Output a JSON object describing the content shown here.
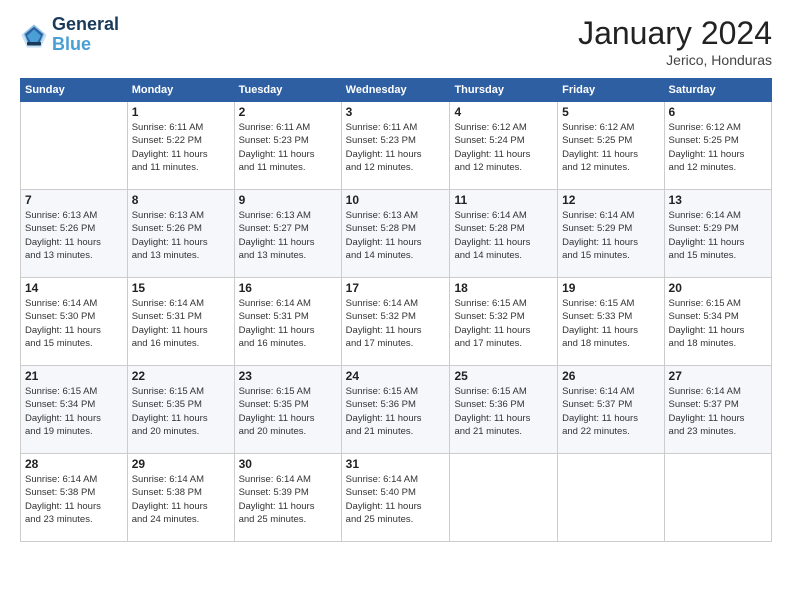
{
  "logo": {
    "line1": "General",
    "line2": "Blue"
  },
  "header": {
    "month": "January 2024",
    "location": "Jerico, Honduras"
  },
  "weekdays": [
    "Sunday",
    "Monday",
    "Tuesday",
    "Wednesday",
    "Thursday",
    "Friday",
    "Saturday"
  ],
  "weeks": [
    [
      {
        "day": "",
        "info": ""
      },
      {
        "day": "1",
        "info": "Sunrise: 6:11 AM\nSunset: 5:22 PM\nDaylight: 11 hours\nand 11 minutes."
      },
      {
        "day": "2",
        "info": "Sunrise: 6:11 AM\nSunset: 5:23 PM\nDaylight: 11 hours\nand 11 minutes."
      },
      {
        "day": "3",
        "info": "Sunrise: 6:11 AM\nSunset: 5:23 PM\nDaylight: 11 hours\nand 12 minutes."
      },
      {
        "day": "4",
        "info": "Sunrise: 6:12 AM\nSunset: 5:24 PM\nDaylight: 11 hours\nand 12 minutes."
      },
      {
        "day": "5",
        "info": "Sunrise: 6:12 AM\nSunset: 5:25 PM\nDaylight: 11 hours\nand 12 minutes."
      },
      {
        "day": "6",
        "info": "Sunrise: 6:12 AM\nSunset: 5:25 PM\nDaylight: 11 hours\nand 12 minutes."
      }
    ],
    [
      {
        "day": "7",
        "info": "Sunrise: 6:13 AM\nSunset: 5:26 PM\nDaylight: 11 hours\nand 13 minutes."
      },
      {
        "day": "8",
        "info": "Sunrise: 6:13 AM\nSunset: 5:26 PM\nDaylight: 11 hours\nand 13 minutes."
      },
      {
        "day": "9",
        "info": "Sunrise: 6:13 AM\nSunset: 5:27 PM\nDaylight: 11 hours\nand 13 minutes."
      },
      {
        "day": "10",
        "info": "Sunrise: 6:13 AM\nSunset: 5:28 PM\nDaylight: 11 hours\nand 14 minutes."
      },
      {
        "day": "11",
        "info": "Sunrise: 6:14 AM\nSunset: 5:28 PM\nDaylight: 11 hours\nand 14 minutes."
      },
      {
        "day": "12",
        "info": "Sunrise: 6:14 AM\nSunset: 5:29 PM\nDaylight: 11 hours\nand 15 minutes."
      },
      {
        "day": "13",
        "info": "Sunrise: 6:14 AM\nSunset: 5:29 PM\nDaylight: 11 hours\nand 15 minutes."
      }
    ],
    [
      {
        "day": "14",
        "info": "Sunrise: 6:14 AM\nSunset: 5:30 PM\nDaylight: 11 hours\nand 15 minutes."
      },
      {
        "day": "15",
        "info": "Sunrise: 6:14 AM\nSunset: 5:31 PM\nDaylight: 11 hours\nand 16 minutes."
      },
      {
        "day": "16",
        "info": "Sunrise: 6:14 AM\nSunset: 5:31 PM\nDaylight: 11 hours\nand 16 minutes."
      },
      {
        "day": "17",
        "info": "Sunrise: 6:14 AM\nSunset: 5:32 PM\nDaylight: 11 hours\nand 17 minutes."
      },
      {
        "day": "18",
        "info": "Sunrise: 6:15 AM\nSunset: 5:32 PM\nDaylight: 11 hours\nand 17 minutes."
      },
      {
        "day": "19",
        "info": "Sunrise: 6:15 AM\nSunset: 5:33 PM\nDaylight: 11 hours\nand 18 minutes."
      },
      {
        "day": "20",
        "info": "Sunrise: 6:15 AM\nSunset: 5:34 PM\nDaylight: 11 hours\nand 18 minutes."
      }
    ],
    [
      {
        "day": "21",
        "info": "Sunrise: 6:15 AM\nSunset: 5:34 PM\nDaylight: 11 hours\nand 19 minutes."
      },
      {
        "day": "22",
        "info": "Sunrise: 6:15 AM\nSunset: 5:35 PM\nDaylight: 11 hours\nand 20 minutes."
      },
      {
        "day": "23",
        "info": "Sunrise: 6:15 AM\nSunset: 5:35 PM\nDaylight: 11 hours\nand 20 minutes."
      },
      {
        "day": "24",
        "info": "Sunrise: 6:15 AM\nSunset: 5:36 PM\nDaylight: 11 hours\nand 21 minutes."
      },
      {
        "day": "25",
        "info": "Sunrise: 6:15 AM\nSunset: 5:36 PM\nDaylight: 11 hours\nand 21 minutes."
      },
      {
        "day": "26",
        "info": "Sunrise: 6:14 AM\nSunset: 5:37 PM\nDaylight: 11 hours\nand 22 minutes."
      },
      {
        "day": "27",
        "info": "Sunrise: 6:14 AM\nSunset: 5:37 PM\nDaylight: 11 hours\nand 23 minutes."
      }
    ],
    [
      {
        "day": "28",
        "info": "Sunrise: 6:14 AM\nSunset: 5:38 PM\nDaylight: 11 hours\nand 23 minutes."
      },
      {
        "day": "29",
        "info": "Sunrise: 6:14 AM\nSunset: 5:38 PM\nDaylight: 11 hours\nand 24 minutes."
      },
      {
        "day": "30",
        "info": "Sunrise: 6:14 AM\nSunset: 5:39 PM\nDaylight: 11 hours\nand 25 minutes."
      },
      {
        "day": "31",
        "info": "Sunrise: 6:14 AM\nSunset: 5:40 PM\nDaylight: 11 hours\nand 25 minutes."
      },
      {
        "day": "",
        "info": ""
      },
      {
        "day": "",
        "info": ""
      },
      {
        "day": "",
        "info": ""
      }
    ]
  ]
}
